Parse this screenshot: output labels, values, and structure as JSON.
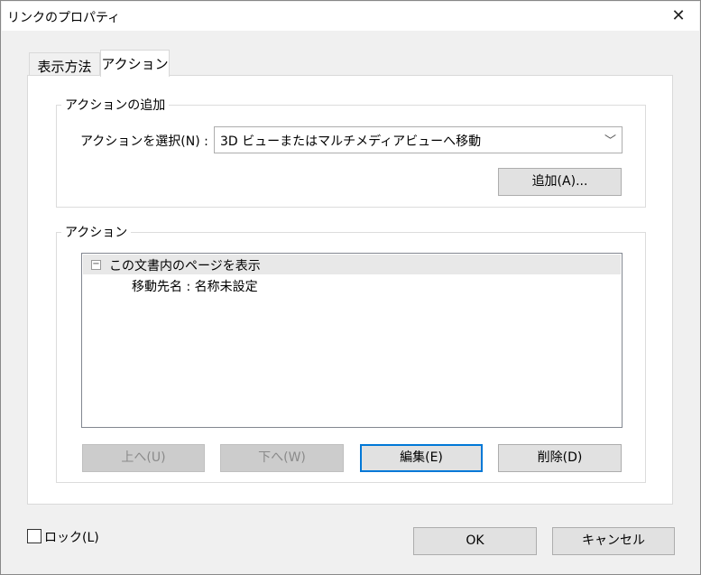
{
  "window": {
    "title": "リンクのプロパティ",
    "close": "✕"
  },
  "tabs": [
    {
      "label": "表示方法"
    },
    {
      "label": "アクション",
      "active": true
    }
  ],
  "add_group": {
    "legend": "アクションの追加",
    "select_label": "アクションを選択(N) :",
    "select_value": "3D ビューまたはマルチメディアビューへ移動",
    "add_button": "追加(A)..."
  },
  "actions_group": {
    "legend": "アクション",
    "tree": [
      {
        "label": "この文書内のページを表示",
        "expander": "−",
        "children": [
          {
            "label": "移動先名 : 名称未設定"
          }
        ]
      }
    ],
    "buttons": {
      "up": "上へ(U)",
      "down": "下へ(W)",
      "edit": "編集(E)",
      "delete": "削除(D)"
    }
  },
  "footer": {
    "lock_label": "ロック(L)",
    "lock_checked": false,
    "ok": "OK",
    "cancel": "キャンセル"
  }
}
